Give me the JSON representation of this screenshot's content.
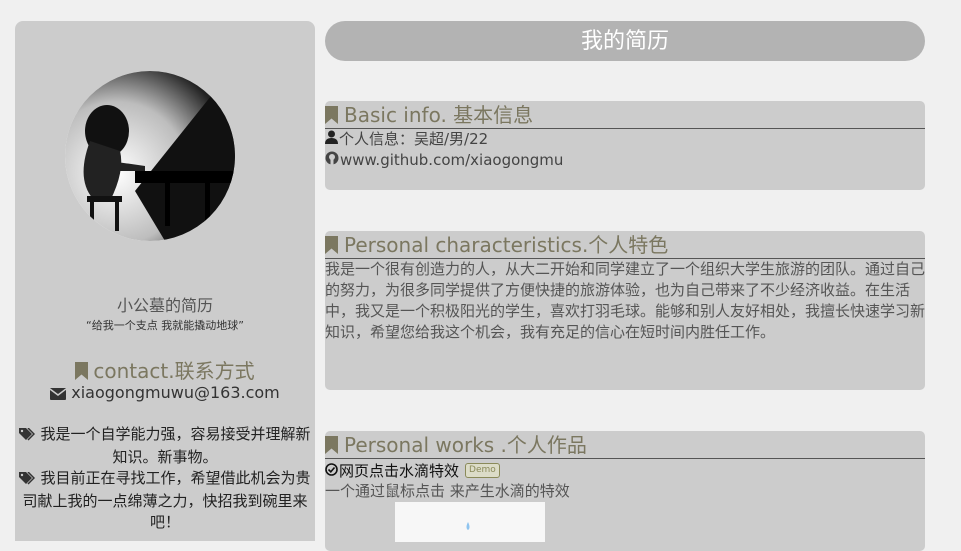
{
  "page": {
    "title": "我的简历"
  },
  "sidebar": {
    "name": "小公墓的简历",
    "motto": "“给我一个支点 我就能撬动地球”",
    "contact_heading": "contact.联系方式",
    "email": "xiaogongmuwu@163.com",
    "intro": [
      "我是一个自学能力强，容易接受并理解新知识。新事物。",
      "我目前正在寻找工作，希望借此机会为贵司献上我的一点绵薄之力，快招我到碗里来吧！"
    ]
  },
  "basic": {
    "heading": "Basic info. 基本信息",
    "personal": "个人信息：吴超/男/22",
    "github": "www.github.com/xiaogongmu"
  },
  "characteristics": {
    "heading": "Personal characteristics.个人特色",
    "text": "我是一个很有创造力的人，从大二开始和同学建立了一个组织大学生旅游的团队。通过自己的努力，为很多同学提供了方便快捷的旅游体验，也为自己带来了不少经济收益。在生活中，我又是一个积极阳光的学生，喜欢打羽毛球。能够和别人友好相处，我擅长快速学习新知识，希望您给我这个机会，我有充足的信心在短时间内胜任工作。"
  },
  "works": {
    "heading": "Personal works .个人作品",
    "items": [
      {
        "title": "网页点击水滴特效",
        "badge": "Demo",
        "desc": "一个通过鼠标点击 来产生水滴的特效"
      }
    ]
  },
  "colors": {
    "accent": "#7b7760",
    "panel": "#cccccc",
    "title_bar": "#b3b3b3",
    "background": "#f0f0f0"
  }
}
